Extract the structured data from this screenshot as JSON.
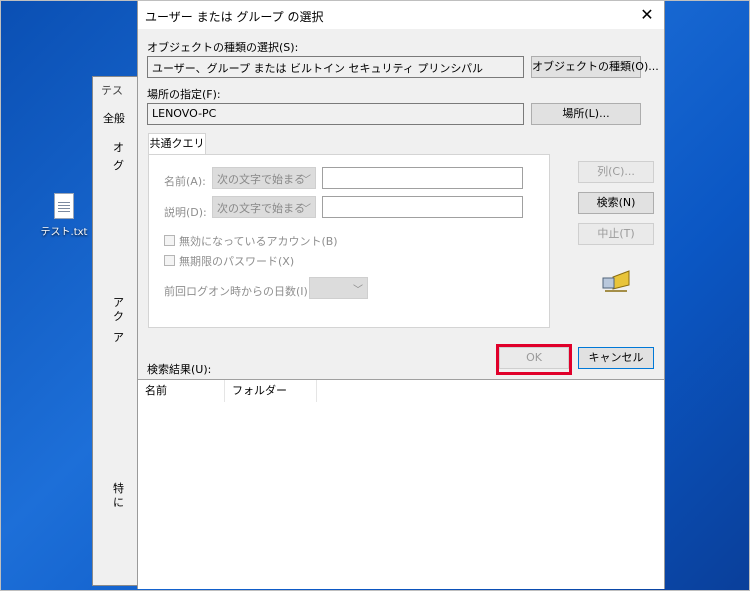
{
  "desktop": {
    "file_label": "テスト.txt"
  },
  "background_window": {
    "title_fragment": "テス",
    "tab_fragment": "全般",
    "frags": [
      "オ",
      "グ",
      "ア",
      "ク",
      "ア",
      "特",
      "に"
    ]
  },
  "dialog": {
    "title": "ユーザー または グループ の選択",
    "close_glyph": "✕",
    "object_type_label": "オブジェクトの種類の選択(S):",
    "object_type_value": "ユーザー、グループ または ビルトイン セキュリティ プリンシパル",
    "object_type_button": "オブジェクトの種類(O)...",
    "location_label": "場所の指定(F):",
    "location_value": "LENOVO-PC",
    "location_button": "場所(L)...",
    "tab_label": "共通クエリ",
    "query": {
      "name_label": "名前(A):",
      "name_combo": "次の文字で始まる",
      "desc_label": "説明(D):",
      "desc_combo": "次の文字で始まる",
      "disabled_accounts": "無効になっているアカウント(B)",
      "no_expiry_password": "無期限のパスワード(X)",
      "days_since_logon": "前回ログオン時からの日数(I):"
    },
    "buttons": {
      "columns": "列(C)...",
      "search": "検索(N)",
      "stop": "中止(T)",
      "ok": "OK",
      "cancel": "キャンセル"
    },
    "results_label": "検索結果(U):",
    "results_columns": [
      "名前",
      "フォルダー"
    ]
  },
  "colors": {
    "highlight": "#e0002a",
    "desktop_blue": "#1d6fd8"
  }
}
